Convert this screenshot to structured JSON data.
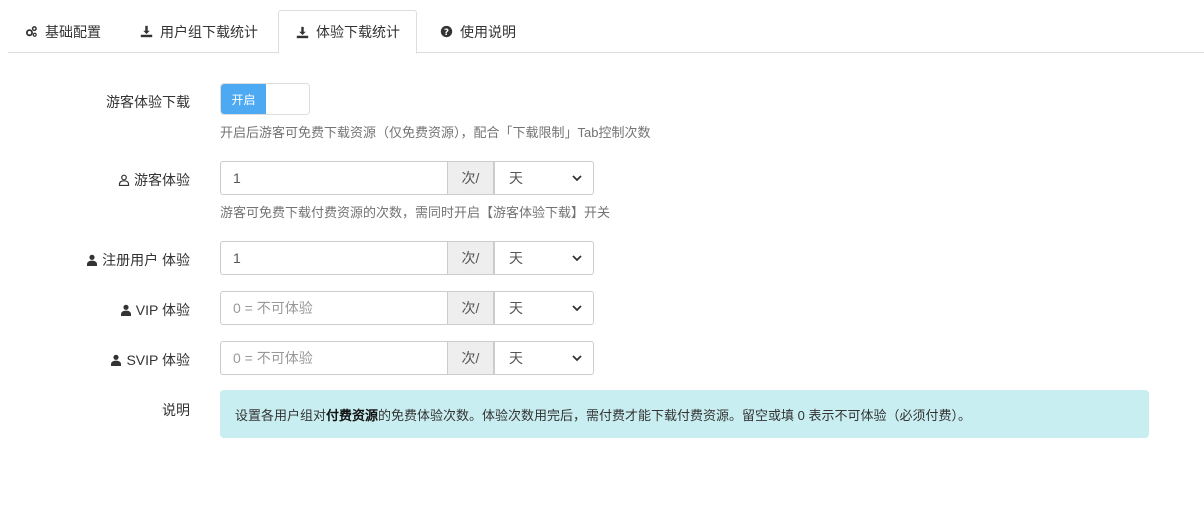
{
  "tabs": [
    {
      "label": "基础配置",
      "icon": "gears-icon",
      "active": false
    },
    {
      "label": "用户组下载统计",
      "icon": "download-icon",
      "active": false
    },
    {
      "label": "体验下载统计",
      "icon": "download-icon",
      "active": true
    },
    {
      "label": "使用说明",
      "icon": "question-circle-icon",
      "active": false
    }
  ],
  "guest_download": {
    "label": "游客体验下载",
    "switch_label": "开启",
    "help": "开启后游客可免费下载资源（仅免费资源），配合「下载限制」Tab控制次数"
  },
  "rows": [
    {
      "label": "游客体验",
      "icon": "user-outline-icon",
      "value": "1",
      "placeholder": "",
      "unit": "次/",
      "period": "天"
    },
    {
      "label": "注册用户 体验",
      "icon": "user-solid-icon",
      "value": "1",
      "placeholder": "",
      "unit": "次/",
      "period": "天"
    },
    {
      "label": "VIP 体验",
      "icon": "user-solid-icon",
      "value": "",
      "placeholder": "0 = 不可体验",
      "unit": "次/",
      "period": "天"
    },
    {
      "label": "SVIP 体验",
      "icon": "user-solid-icon",
      "value": "",
      "placeholder": "0 = 不可体验",
      "unit": "次/",
      "period": "天"
    }
  ],
  "guest_help": "游客可免费下载付费资源的次数，需同时开启【游客体验下载】开关",
  "note": {
    "label": "说明",
    "text_before": "设置各用户组对",
    "text_bold": "付费资源",
    "text_after": "的免费体验次数。体验次数用完后，需付费才能下载付费资源。留空或填 0 表示不可体验（必须付费）。"
  },
  "colors": {
    "switch_on": "#4da9f2",
    "alert_bg": "#c9eef1"
  }
}
